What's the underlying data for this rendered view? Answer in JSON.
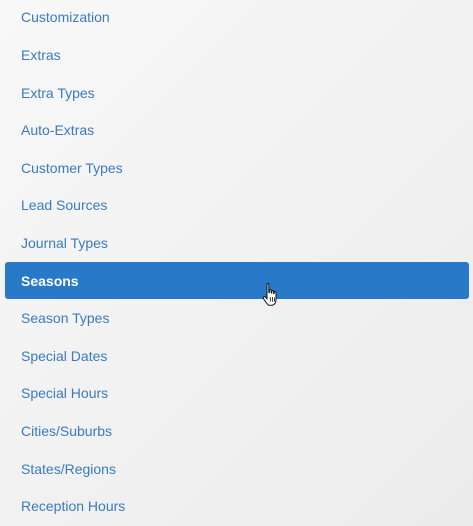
{
  "menu": {
    "items": [
      {
        "label": "Customization"
      },
      {
        "label": "Extras"
      },
      {
        "label": "Extra Types"
      },
      {
        "label": "Auto-Extras"
      },
      {
        "label": "Customer Types"
      },
      {
        "label": "Lead Sources"
      },
      {
        "label": "Journal Types"
      },
      {
        "label": "Seasons",
        "active": true
      },
      {
        "label": "Season Types"
      },
      {
        "label": "Special Dates"
      },
      {
        "label": "Special Hours"
      },
      {
        "label": "Cities/Suburbs"
      },
      {
        "label": "States/Regions"
      },
      {
        "label": "Reception Hours"
      }
    ]
  },
  "colors": {
    "link": "#3a7bbf",
    "active_bg": "#2979c9",
    "active_text": "#ffffff"
  },
  "cursor": {
    "icon": "hand-pointer-icon"
  }
}
